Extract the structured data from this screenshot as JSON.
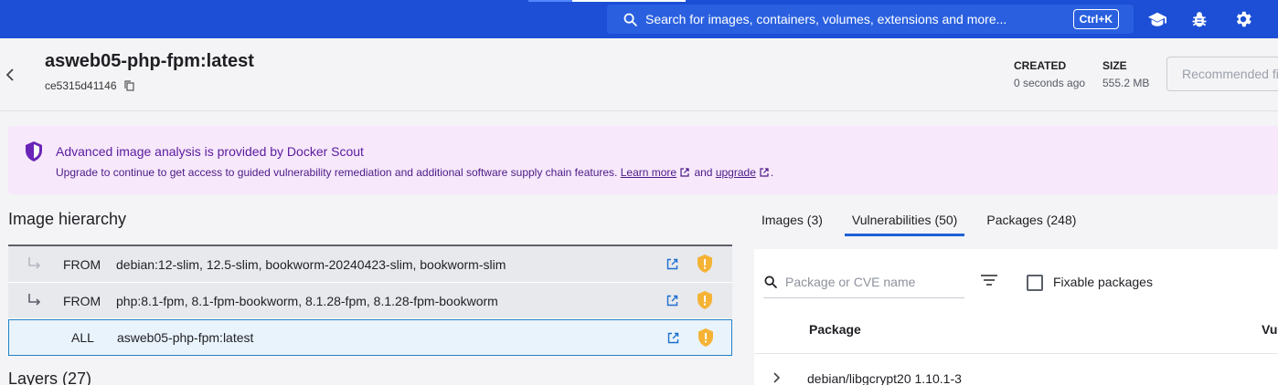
{
  "topbar": {
    "search_placeholder": "Search for images, containers, volumes, extensions and more...",
    "shortcut": "Ctrl+K",
    "icons": [
      "search-icon",
      "graduation-cap-icon",
      "bug-icon",
      "gear-icon"
    ],
    "bg_color": "#1c4fd6"
  },
  "header": {
    "title": "asweb05-php-fpm:latest",
    "image_id": "ce5315d41146",
    "created_label": "CREATED",
    "created_value": "0 seconds ago",
    "size_label": "SIZE",
    "size_value": "555.2 MB",
    "recommended_button": "Recommended fi"
  },
  "banner": {
    "title": "Advanced image analysis is provided by Docker Scout",
    "desc_prefix": "Upgrade to continue to get access to guided vulnerability remediation and additional software supply chain features.",
    "learn_more": "Learn more",
    "and": "and",
    "upgrade": "upgrade",
    "suffix": ".",
    "bg_color": "#f7e8fb"
  },
  "hierarchy": {
    "title": "Image hierarchy",
    "rows": [
      {
        "kind": "FROM",
        "tags": "debian:12-slim, 12.5-slim, bookworm-20240423-slim, bookworm-slim"
      },
      {
        "kind": "FROM",
        "tags": "php:8.1-fpm, 8.1-fpm-bookworm, 8.1.28-fpm, 8.1.28-fpm-bookworm"
      },
      {
        "kind": "ALL",
        "tags": "asweb05-php-fpm:latest"
      }
    ],
    "warning_color": "#f5b335"
  },
  "layers": {
    "title": "Layers (27)"
  },
  "tabs": [
    {
      "label": "Images (3)",
      "active": false
    },
    {
      "label": "Vulnerabilities (50)",
      "active": true
    },
    {
      "label": "Packages (248)",
      "active": false
    }
  ],
  "vuln_panel": {
    "filter_placeholder": "Package or CVE name",
    "fixable_label": "Fixable packages",
    "col_package": "Package",
    "col_vul": "Vul",
    "rows": [
      {
        "package": "debian/libgcrypt20 1.10.1-3"
      }
    ]
  }
}
